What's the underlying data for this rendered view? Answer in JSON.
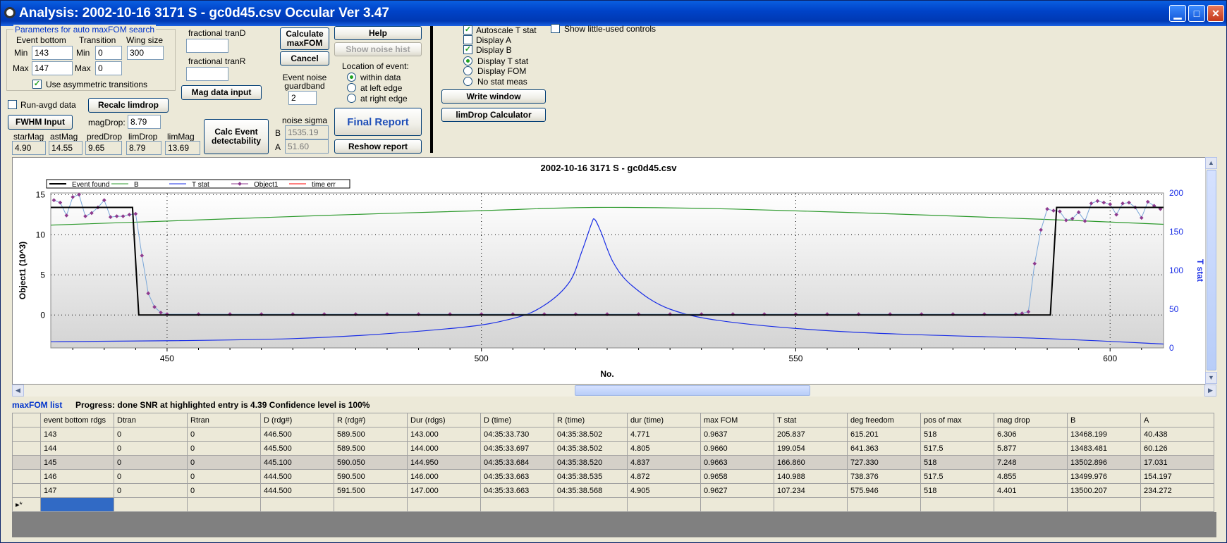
{
  "window": {
    "title": "Analysis: 2002-10-16 3171 S - gc0d45.csv  Occular Ver 3.47"
  },
  "params": {
    "group_label": "Parameters for auto maxFOM search",
    "event_bottom_label": "Event bottom",
    "transition_label": "Transition",
    "wing_size_label": "Wing size",
    "min_label": "Min",
    "max_label": "Max",
    "min_label2": "Min",
    "max_label2": "Max",
    "event_bottom_min": "143",
    "event_bottom_max": "147",
    "transition_min": "0",
    "transition_max": "0",
    "wing_size": "300",
    "use_asym_label": "Use asymmetric transitions",
    "frac_tranD_label": "fractional tranD",
    "frac_tranR_label": "fractional tranR",
    "frac_tranD": "",
    "frac_tranR": ""
  },
  "controls": {
    "run_avgd_label": "Run-avgd data",
    "recalc_limdrop": "Recalc limdrop",
    "mag_data_input": "Mag data input",
    "fwhm_input": "FWHM Input",
    "magdrop_label": "magDrop:",
    "magdrop_value": "8.79",
    "calc_event_detect": "Calc Event detectability",
    "calc_maxfom": "Calculate maxFOM",
    "cancel": "Cancel",
    "help": "Help",
    "show_noise_hist": "Show noise hist",
    "location_label": "Location of event:",
    "loc_within": "within data",
    "loc_left": "at left edge",
    "loc_right": "at right edge",
    "guardband_label": "Event noise guardband",
    "guardband_value": "2",
    "noise_sigma_label": "noise sigma",
    "noise_b_label": "B",
    "noise_a_label": "A",
    "noise_b_value": "1535.19",
    "noise_a_value": "51.60",
    "final_report": "Final Report",
    "reshow_report": "Reshow report",
    "autoscale_label": "Autoscale T stat",
    "display_a_label": "Display A",
    "display_b_label": "Display B",
    "display_t_label": "Display T stat",
    "display_fom_label": "Display FOM",
    "no_stat_label": "No stat meas",
    "show_little_label": "Show little-used controls",
    "write_window": "Write window",
    "limdrop_calc": "limDrop Calculator"
  },
  "mags": {
    "labels": [
      "starMag",
      "astMag",
      "predDrop",
      "limDrop",
      "limMag"
    ],
    "values": [
      "4.90",
      "14.55",
      "9.65",
      "8.79",
      "13.69"
    ]
  },
  "chart_data": {
    "type": "line",
    "title": "2002-10-16 3171 S - gc0d45.csv",
    "xlabel": "No.",
    "ylabel": "Object1 (10^3)",
    "y2label": "T stat",
    "xlim": [
      431.5,
      608.5
    ],
    "ylim": [
      -4.1,
      15.2
    ],
    "y2lim": [
      0,
      200
    ],
    "xticks": [
      450,
      500,
      550,
      600
    ],
    "yticks": [
      0,
      5,
      10,
      15
    ],
    "y2ticks": [
      0,
      50,
      100,
      150,
      200
    ],
    "legend": [
      "Event found",
      "B",
      "T stat",
      "Object1",
      "time err"
    ],
    "legend_colors": [
      "#000000",
      "#2e9a2e",
      "#1a2ee6",
      "#8e3a8e",
      "#ff0000"
    ],
    "event_found": {
      "x": [
        431.5,
        444.5,
        445.5,
        590.5,
        591.5,
        608.5
      ],
      "y": [
        13.4,
        13.4,
        0,
        0,
        13.4,
        13.4
      ]
    },
    "b_series": {
      "x": [
        431.5,
        450,
        475,
        500,
        518,
        540,
        565,
        590,
        608.5
      ],
      "y": [
        11.2,
        11.7,
        12.4,
        13.0,
        13.4,
        13.2,
        12.6,
        11.9,
        11.3
      ]
    },
    "tstat_series": {
      "x": [
        431.5,
        470,
        495,
        505,
        510,
        514,
        516,
        517.5,
        518,
        519,
        521,
        524,
        530,
        540,
        560,
        590,
        608.5
      ],
      "y": [
        8,
        12,
        25,
        38,
        55,
        85,
        125,
        160,
        166,
        150,
        110,
        80,
        50,
        33,
        20,
        12,
        5
      ]
    },
    "object1_series": {
      "x": [
        432,
        433,
        434,
        435,
        436,
        437,
        438,
        439,
        440,
        441,
        442,
        443,
        444,
        445,
        446,
        447,
        448,
        449,
        450,
        455,
        460,
        465,
        470,
        475,
        480,
        485,
        490,
        495,
        500,
        505,
        510,
        515,
        520,
        525,
        530,
        535,
        540,
        545,
        550,
        555,
        560,
        565,
        570,
        575,
        580,
        585,
        586,
        587,
        588,
        589,
        590,
        591,
        592,
        593,
        594,
        595,
        596,
        597,
        598,
        599,
        600,
        601,
        602,
        603,
        604,
        605,
        606,
        607,
        608
      ],
      "y": [
        14.3,
        14.0,
        12.4,
        14.7,
        15.0,
        12.3,
        12.7,
        13.4,
        14.3,
        12.2,
        12.3,
        12.3,
        12.5,
        12.6,
        7.4,
        2.7,
        1.0,
        0.3,
        0.1,
        0.1,
        0.1,
        0.1,
        0.1,
        0.1,
        0.1,
        0.1,
        0.1,
        0.1,
        0.1,
        0.1,
        0.1,
        0.1,
        0.1,
        0.1,
        0.1,
        0.1,
        0.1,
        0.1,
        0.1,
        0.1,
        0.1,
        0.1,
        0.1,
        0.1,
        0.1,
        0.1,
        0.2,
        0.4,
        6.4,
        10.6,
        13.2,
        13.0,
        12.9,
        11.8,
        12.0,
        12.8,
        11.7,
        13.9,
        14.2,
        14.0,
        13.8,
        12.5,
        13.9,
        14.0,
        13.4,
        12.1,
        14.1,
        13.6,
        13.2
      ]
    }
  },
  "list": {
    "title": "maxFOM list",
    "progress": "Progress: done  SNR at highlighted entry is 4.39   Confidence level is  100%",
    "columns": [
      "event bottom rdgs",
      "Dtran",
      "Rtran",
      "D (rdg#)",
      "R (rdg#)",
      "Dur (rdgs)",
      "D (time)",
      "R (time)",
      "dur (time)",
      "max FOM",
      "T stat",
      "deg freedom",
      "pos of max",
      "mag drop",
      "B",
      "A"
    ],
    "rows": [
      [
        "143",
        "0",
        "0",
        "446.500",
        "589.500",
        "143.000",
        "04:35:33.730",
        "04:35:38.502",
        "4.771",
        "0.9637",
        "205.837",
        "615.201",
        "518",
        "6.306",
        "13468.199",
        "40.438"
      ],
      [
        "144",
        "0",
        "0",
        "445.500",
        "589.500",
        "144.000",
        "04:35:33.697",
        "04:35:38.502",
        "4.805",
        "0.9660",
        "199.054",
        "641.363",
        "517.5",
        "5.877",
        "13483.481",
        "60.126"
      ],
      [
        "145",
        "0",
        "0",
        "445.100",
        "590.050",
        "144.950",
        "04:35:33.684",
        "04:35:38.520",
        "4.837",
        "0.9663",
        "166.860",
        "727.330",
        "518",
        "7.248",
        "13502.896",
        "17.031"
      ],
      [
        "146",
        "0",
        "0",
        "444.500",
        "590.500",
        "146.000",
        "04:35:33.663",
        "04:35:38.535",
        "4.872",
        "0.9658",
        "140.988",
        "738.376",
        "517.5",
        "4.855",
        "13499.976",
        "154.197"
      ],
      [
        "147",
        "0",
        "0",
        "444.500",
        "591.500",
        "147.000",
        "04:35:33.663",
        "04:35:38.568",
        "4.905",
        "0.9627",
        "107.234",
        "575.946",
        "518",
        "4.401",
        "13500.207",
        "234.272"
      ]
    ],
    "new_row_marker": "▸*"
  }
}
